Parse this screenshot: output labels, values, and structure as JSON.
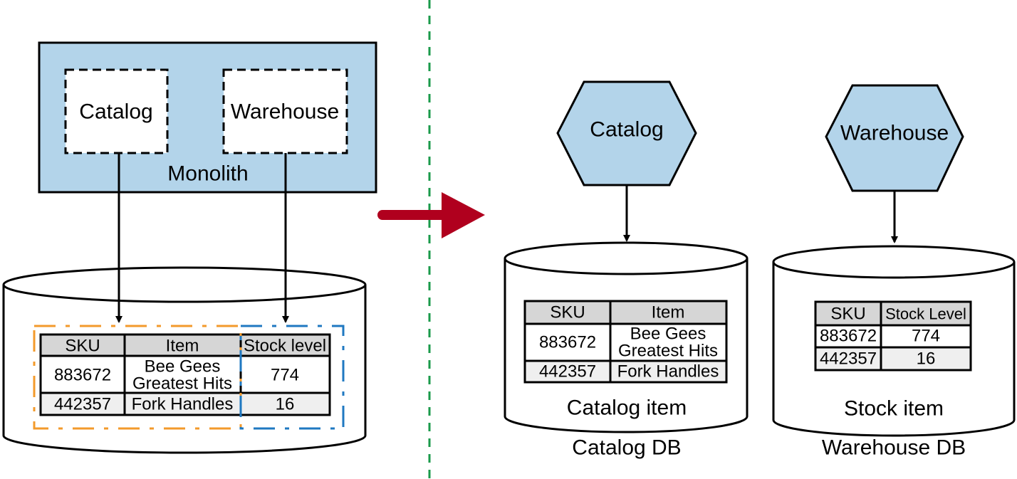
{
  "colors": {
    "service_fill": "#b3d4ea",
    "header_fill": "#d6d6d6",
    "alt_row_fill": "#efefef",
    "catalog_scope": "#f39a2b",
    "warehouse_scope": "#1f78c1",
    "divider": "#1a9a4a",
    "transition_arrow": "#b0001e"
  },
  "before": {
    "monolith": {
      "label": "Monolith",
      "modules": [
        "Catalog",
        "Warehouse"
      ]
    },
    "table": {
      "headers": [
        "SKU",
        "Item",
        "Stock level"
      ],
      "rows": [
        {
          "sku": "883672",
          "item_line1": "Bee Gees",
          "item_line2": "Greatest Hits",
          "stock": "774"
        },
        {
          "sku": "442357",
          "item": "Fork Handles",
          "stock": "16"
        }
      ]
    }
  },
  "after": {
    "services": [
      "Catalog",
      "Warehouse"
    ],
    "catalog_db": {
      "label": "Catalog DB",
      "table_label": "Catalog item",
      "headers": [
        "SKU",
        "Item"
      ],
      "rows": [
        {
          "sku": "883672",
          "item_line1": "Bee Gees",
          "item_line2": "Greatest Hits"
        },
        {
          "sku": "442357",
          "item": "Fork Handles"
        }
      ]
    },
    "warehouse_db": {
      "label": "Warehouse DB",
      "table_label": "Stock item",
      "headers": [
        "SKU",
        "Stock Level"
      ],
      "rows": [
        {
          "sku": "883672",
          "stock": "774"
        },
        {
          "sku": "442357",
          "stock": "16"
        }
      ]
    }
  }
}
